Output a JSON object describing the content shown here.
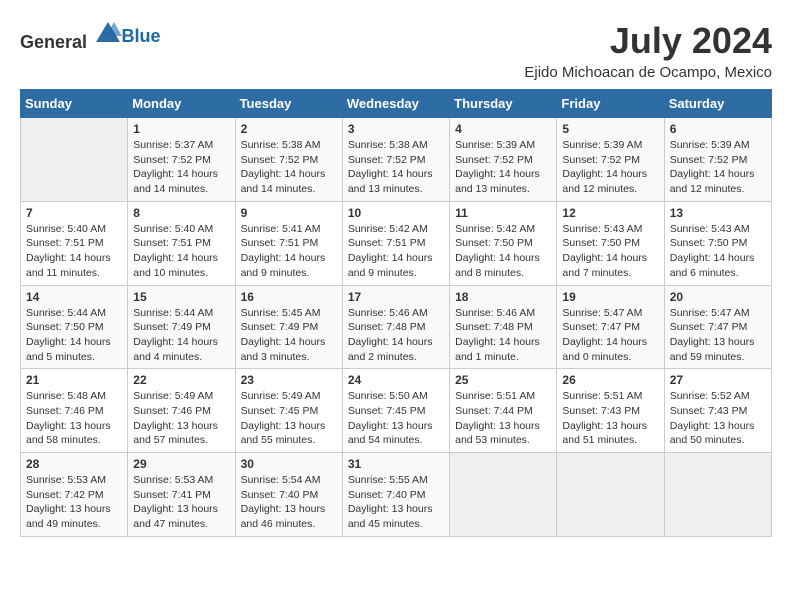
{
  "header": {
    "logo_general": "General",
    "logo_blue": "Blue",
    "month_title": "July 2024",
    "location": "Ejido Michoacan de Ocampo, Mexico"
  },
  "weekdays": [
    "Sunday",
    "Monday",
    "Tuesday",
    "Wednesday",
    "Thursday",
    "Friday",
    "Saturday"
  ],
  "weeks": [
    [
      {
        "day": "",
        "info": ""
      },
      {
        "day": "1",
        "info": "Sunrise: 5:37 AM\nSunset: 7:52 PM\nDaylight: 14 hours\nand 14 minutes."
      },
      {
        "day": "2",
        "info": "Sunrise: 5:38 AM\nSunset: 7:52 PM\nDaylight: 14 hours\nand 14 minutes."
      },
      {
        "day": "3",
        "info": "Sunrise: 5:38 AM\nSunset: 7:52 PM\nDaylight: 14 hours\nand 13 minutes."
      },
      {
        "day": "4",
        "info": "Sunrise: 5:39 AM\nSunset: 7:52 PM\nDaylight: 14 hours\nand 13 minutes."
      },
      {
        "day": "5",
        "info": "Sunrise: 5:39 AM\nSunset: 7:52 PM\nDaylight: 14 hours\nand 12 minutes."
      },
      {
        "day": "6",
        "info": "Sunrise: 5:39 AM\nSunset: 7:52 PM\nDaylight: 14 hours\nand 12 minutes."
      }
    ],
    [
      {
        "day": "7",
        "info": "Sunrise: 5:40 AM\nSunset: 7:51 PM\nDaylight: 14 hours\nand 11 minutes."
      },
      {
        "day": "8",
        "info": "Sunrise: 5:40 AM\nSunset: 7:51 PM\nDaylight: 14 hours\nand 10 minutes."
      },
      {
        "day": "9",
        "info": "Sunrise: 5:41 AM\nSunset: 7:51 PM\nDaylight: 14 hours\nand 9 minutes."
      },
      {
        "day": "10",
        "info": "Sunrise: 5:42 AM\nSunset: 7:51 PM\nDaylight: 14 hours\nand 9 minutes."
      },
      {
        "day": "11",
        "info": "Sunrise: 5:42 AM\nSunset: 7:50 PM\nDaylight: 14 hours\nand 8 minutes."
      },
      {
        "day": "12",
        "info": "Sunrise: 5:43 AM\nSunset: 7:50 PM\nDaylight: 14 hours\nand 7 minutes."
      },
      {
        "day": "13",
        "info": "Sunrise: 5:43 AM\nSunset: 7:50 PM\nDaylight: 14 hours\nand 6 minutes."
      }
    ],
    [
      {
        "day": "14",
        "info": "Sunrise: 5:44 AM\nSunset: 7:50 PM\nDaylight: 14 hours\nand 5 minutes."
      },
      {
        "day": "15",
        "info": "Sunrise: 5:44 AM\nSunset: 7:49 PM\nDaylight: 14 hours\nand 4 minutes."
      },
      {
        "day": "16",
        "info": "Sunrise: 5:45 AM\nSunset: 7:49 PM\nDaylight: 14 hours\nand 3 minutes."
      },
      {
        "day": "17",
        "info": "Sunrise: 5:46 AM\nSunset: 7:48 PM\nDaylight: 14 hours\nand 2 minutes."
      },
      {
        "day": "18",
        "info": "Sunrise: 5:46 AM\nSunset: 7:48 PM\nDaylight: 14 hours\nand 1 minute."
      },
      {
        "day": "19",
        "info": "Sunrise: 5:47 AM\nSunset: 7:47 PM\nDaylight: 14 hours\nand 0 minutes."
      },
      {
        "day": "20",
        "info": "Sunrise: 5:47 AM\nSunset: 7:47 PM\nDaylight: 13 hours\nand 59 minutes."
      }
    ],
    [
      {
        "day": "21",
        "info": "Sunrise: 5:48 AM\nSunset: 7:46 PM\nDaylight: 13 hours\nand 58 minutes."
      },
      {
        "day": "22",
        "info": "Sunrise: 5:49 AM\nSunset: 7:46 PM\nDaylight: 13 hours\nand 57 minutes."
      },
      {
        "day": "23",
        "info": "Sunrise: 5:49 AM\nSunset: 7:45 PM\nDaylight: 13 hours\nand 55 minutes."
      },
      {
        "day": "24",
        "info": "Sunrise: 5:50 AM\nSunset: 7:45 PM\nDaylight: 13 hours\nand 54 minutes."
      },
      {
        "day": "25",
        "info": "Sunrise: 5:51 AM\nSunset: 7:44 PM\nDaylight: 13 hours\nand 53 minutes."
      },
      {
        "day": "26",
        "info": "Sunrise: 5:51 AM\nSunset: 7:43 PM\nDaylight: 13 hours\nand 51 minutes."
      },
      {
        "day": "27",
        "info": "Sunrise: 5:52 AM\nSunset: 7:43 PM\nDaylight: 13 hours\nand 50 minutes."
      }
    ],
    [
      {
        "day": "28",
        "info": "Sunrise: 5:53 AM\nSunset: 7:42 PM\nDaylight: 13 hours\nand 49 minutes."
      },
      {
        "day": "29",
        "info": "Sunrise: 5:53 AM\nSunset: 7:41 PM\nDaylight: 13 hours\nand 47 minutes."
      },
      {
        "day": "30",
        "info": "Sunrise: 5:54 AM\nSunset: 7:40 PM\nDaylight: 13 hours\nand 46 minutes."
      },
      {
        "day": "31",
        "info": "Sunrise: 5:55 AM\nSunset: 7:40 PM\nDaylight: 13 hours\nand 45 minutes."
      },
      {
        "day": "",
        "info": ""
      },
      {
        "day": "",
        "info": ""
      },
      {
        "day": "",
        "info": ""
      }
    ]
  ]
}
